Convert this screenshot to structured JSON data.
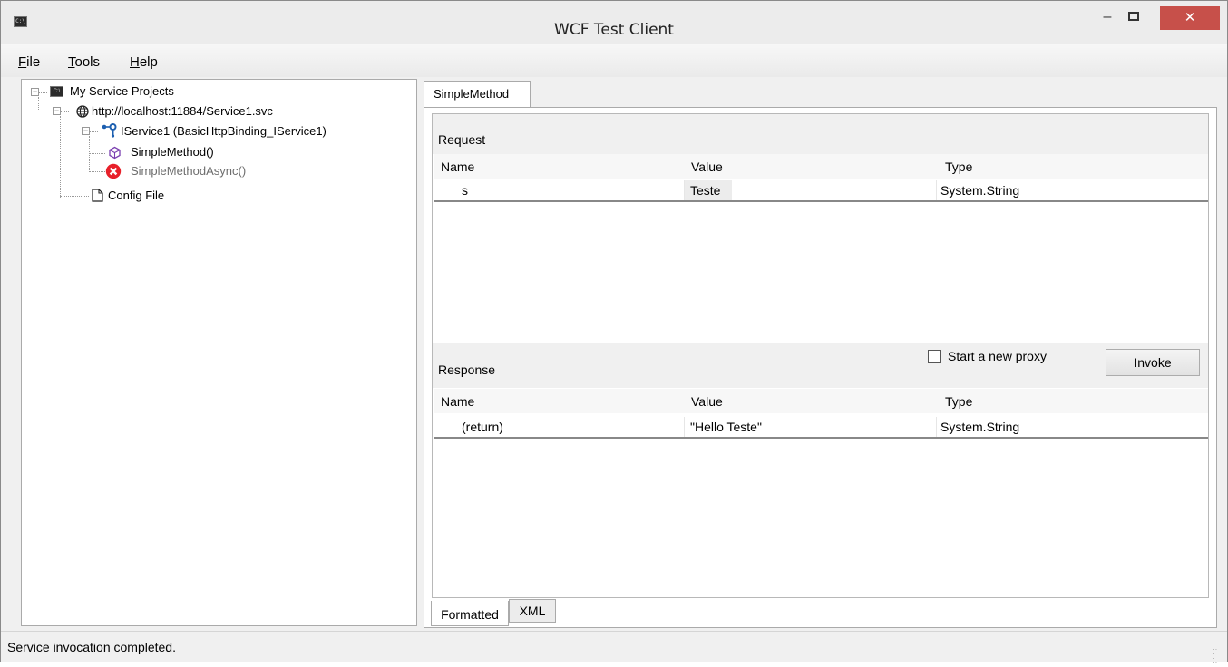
{
  "window": {
    "title": "WCF Test Client",
    "app_icon": "console-icon",
    "controls": {
      "minimize": "–",
      "maximize": "□",
      "close": "✕"
    }
  },
  "menu": [
    {
      "label": "File",
      "accel": "F",
      "rest": "ile"
    },
    {
      "label": "Tools",
      "accel": "T",
      "rest": "ools"
    },
    {
      "label": "Help",
      "accel": "H",
      "rest": "elp"
    }
  ],
  "tree": {
    "root": {
      "label": "My Service Projects",
      "icon": "console-icon",
      "expanded": true
    },
    "endpoint": {
      "label": "http://localhost:11884/Service1.svc",
      "icon": "globe-icon",
      "expanded": true
    },
    "contract": {
      "label": "IService1 (BasicHttpBinding_IService1)",
      "icon": "interface-icon",
      "expanded": true
    },
    "methods": [
      {
        "label": "SimpleMethod()",
        "icon": "method-cube-icon",
        "enabled": true
      },
      {
        "label": "SimpleMethodAsync()",
        "icon": "error-icon",
        "enabled": false
      }
    ],
    "config": {
      "label": "Config File",
      "icon": "document-icon"
    }
  },
  "tab": {
    "label": "SimpleMethod"
  },
  "request": {
    "heading": "Request",
    "columns": [
      "Name",
      "Value",
      "Type"
    ],
    "rows": [
      {
        "name": "s",
        "value": "Teste",
        "type": "System.String"
      }
    ]
  },
  "response": {
    "heading": "Response",
    "new_proxy_label": "Start a new proxy",
    "new_proxy_checked": false,
    "invoke_label": "Invoke",
    "columns": [
      "Name",
      "Value",
      "Type"
    ],
    "rows": [
      {
        "name": "(return)",
        "value": "\"Hello Teste\"",
        "type": "System.String"
      }
    ]
  },
  "bottom_tabs": [
    {
      "label": "Formatted",
      "active": true
    },
    {
      "label": "XML",
      "active": false
    }
  ],
  "status": {
    "text": "Service invocation completed."
  },
  "colors": {
    "close_button": "#c7504a",
    "disabled_text": "#6d6d6d",
    "interface_blue": "#1c5fb0"
  }
}
